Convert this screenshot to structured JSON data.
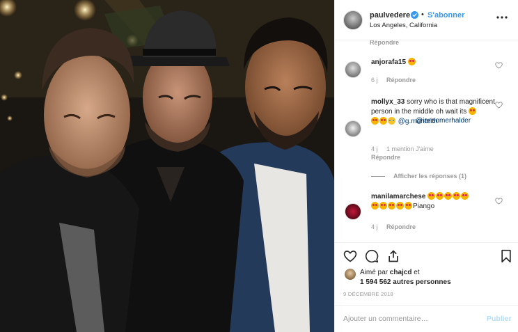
{
  "post": {
    "username": "paulvedere",
    "verified": true,
    "follow_label": "S'abonner",
    "separator": "•",
    "location": "Los Angeles, California",
    "more_icon": "more-dots-icon"
  },
  "comments": {
    "top_partial_action": "Répondre",
    "items": [
      {
        "username": "anjorafa15",
        "text": "",
        "emojis": [
          "heart-eyes"
        ],
        "time": "6 j",
        "likes": "",
        "reply_label": "Répondre"
      },
      {
        "username": "mollyx_33",
        "text_before": "sorry who is that magnificent person in the middle oh wait its",
        "mention1": "@iansomerhalder",
        "mention2": "@g.monteith",
        "emojis": [
          "heart-eyes",
          "heart-eyes",
          "heart-eyes",
          "laughing"
        ],
        "time": "4 j",
        "likes": "1 mention J'aime",
        "reply_label": "Répondre",
        "view_replies": "Afficher les réponses (1)"
      },
      {
        "username": "manilamarchese",
        "text_after": "Piango",
        "emojis": [
          "heart-eyes",
          "heart-eyes",
          "heart-eyes",
          "heart-eyes",
          "heart-eyes",
          "heart-eyes",
          "heart-eyes",
          "heart-eyes",
          "heart-eyes",
          "heart-eyes"
        ],
        "time": "4 j",
        "reply_label": "Répondre"
      }
    ]
  },
  "actions": {
    "like_icon": "heart-outline-icon",
    "comment_icon": "comment-bubble-icon",
    "share_icon": "share-icon",
    "save_icon": "bookmark-icon"
  },
  "likes": {
    "line1_prefix": "Aimé par",
    "liker": "chajcd",
    "line1_suffix": "et",
    "others_count": "1 594 562 autres personnes"
  },
  "date": "9 DÉCEMBRE 2018",
  "add_comment": {
    "placeholder": "Ajouter un commentaire…",
    "publish_label": "Publier"
  },
  "colors": {
    "link_blue": "#3897f0",
    "publish_disabled": "#b2dffc",
    "muted": "#999999",
    "text": "#262626",
    "border": "#efefef"
  }
}
